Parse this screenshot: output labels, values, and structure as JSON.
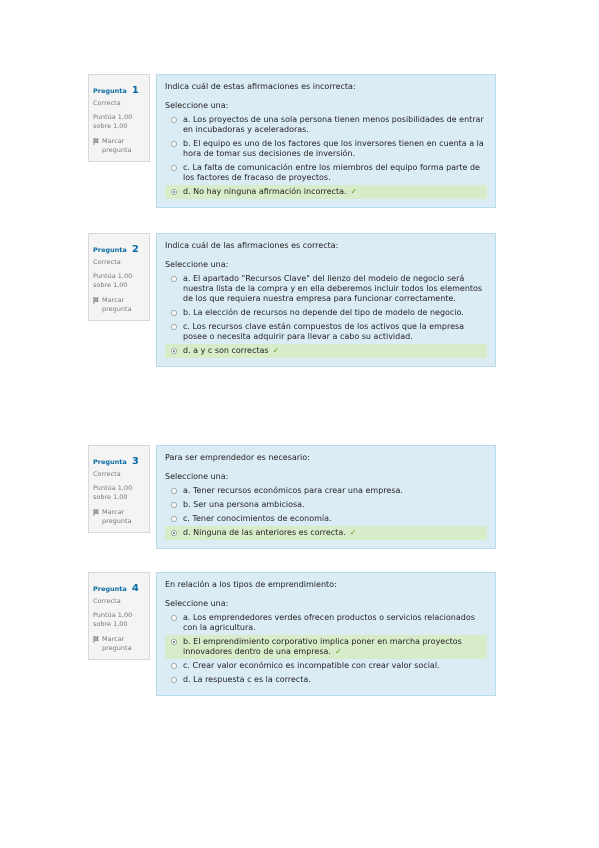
{
  "questions": [
    {
      "label": "Pregunta",
      "number": "1",
      "state": "Correcta",
      "grade": "Puntúa 1,00 sobre 1,00",
      "flag": "Marcar pregunta",
      "text": "Indica cuál de estas afirmaciones es incorrecta:",
      "prompt": "Seleccione una:",
      "options": [
        {
          "text": "a. Los proyectos de una sola persona tienen menos posibilidades de entrar en incubadoras y aceleradoras.",
          "selected": false,
          "correct": false
        },
        {
          "text": "b. El equipo es uno de los factores que los inversores tienen en cuenta a la hora de tomar sus decisiones de inversión.",
          "selected": false,
          "correct": false
        },
        {
          "text": "c. La falta de comunicación entre los miembros del equipo forma parte de los factores de fracaso de proyectos.",
          "selected": false,
          "correct": false
        },
        {
          "text": "d. No hay ninguna afirmación incorrecta.",
          "selected": true,
          "correct": true
        }
      ]
    },
    {
      "label": "Pregunta",
      "number": "2",
      "state": "Correcta",
      "grade": "Puntúa 1,00 sobre 1,00",
      "flag": "Marcar pregunta",
      "text": "Indica cuál de las afirmaciones es correcta:",
      "prompt": "Seleccione una:",
      "options": [
        {
          "text": "a. El apartado \"Recursos Clave\" del lienzo del modelo de negocio será nuestra lista de la compra y en ella deberemos incluir todos los elementos de los que requiera nuestra empresa para funcionar correctamente.",
          "selected": false,
          "correct": false
        },
        {
          "text": "b. La elección de recursos no depende del tipo de modelo de negocio.",
          "selected": false,
          "correct": false
        },
        {
          "text": "c. Los recursos clave están compuestos de los activos que la empresa posee o necesita adquirir para llevar a cabo su actividad.",
          "selected": false,
          "correct": false
        },
        {
          "text": "d. a y c son correctas",
          "selected": true,
          "correct": true
        }
      ]
    },
    {
      "label": "Pregunta",
      "number": "3",
      "state": "Correcta",
      "grade": "Puntúa 1,00 sobre 1,00",
      "flag": "Marcar pregunta",
      "text": "Para ser emprendedor es necesario:",
      "prompt": "Seleccione una:",
      "options": [
        {
          "text": "a. Tener recursos económicos para crear una empresa.",
          "selected": false,
          "correct": false
        },
        {
          "text": "b. Ser una persona ambiciosa.",
          "selected": false,
          "correct": false
        },
        {
          "text": "c. Tener conocimientos de economía.",
          "selected": false,
          "correct": false
        },
        {
          "text": "d. Ninguna de las anteriores es correcta.",
          "selected": true,
          "correct": true
        }
      ]
    },
    {
      "label": "Pregunta",
      "number": "4",
      "state": "Correcta",
      "grade": "Puntúa 1,00 sobre 1,00",
      "flag": "Marcar pregunta",
      "text": "En relación a los tipos de emprendimiento:",
      "prompt": "Seleccione una:",
      "options": [
        {
          "text": "a. Los emprendedores verdes ofrecen productos o servicios relacionados con la agricultura.",
          "selected": false,
          "correct": false
        },
        {
          "text": "b. El emprendimiento corporativo implica poner en marcha proyectos innovadores dentro de una empresa.",
          "selected": true,
          "correct": true
        },
        {
          "text": "c. Crear valor económico es incompatible con crear valor social.",
          "selected": false,
          "correct": false
        },
        {
          "text": "d. La respuesta c es la correcta.",
          "selected": false,
          "correct": false
        }
      ]
    }
  ],
  "correct_mark": "✓",
  "colors": {
    "accent": "#0a6aa1",
    "panel": "#dcecf5",
    "correct_bg": "#d9ecc9",
    "check": "#5aa02c"
  }
}
